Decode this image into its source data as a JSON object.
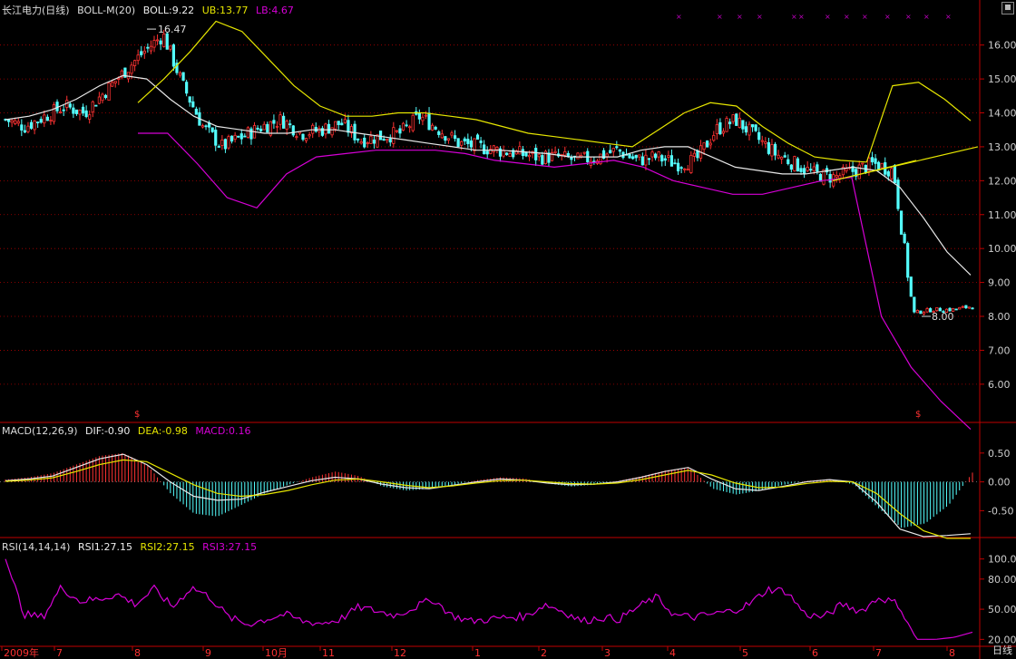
{
  "theme": {
    "bg": "#000000",
    "frame": "#c00000",
    "grid": "#b00000",
    "up": "#ff3232",
    "down": "#54ffff",
    "mid": "#e8e8e8",
    "ub": "#e6e600",
    "lb": "#d600d6",
    "text": "#cccccc"
  },
  "header": {
    "stock": "长江电力(日线)",
    "boll": {
      "name": "BOLL-M(20)",
      "boll": "BOLL:9.22",
      "ub": "UB:13.77",
      "lb": "LB:4.67"
    },
    "macd": {
      "name": "MACD(12,26,9)",
      "dif": "DIF:-0.90",
      "dea": "DEA:-0.98",
      "macd": "MACD:0.16"
    },
    "rsi": {
      "name": "RSI(14,14,14)",
      "rsi1": "RSI1:27.15",
      "rsi2": "RSI2:27.15",
      "rsi3": "RSI3:27.15"
    }
  },
  "mode_label": "日线",
  "chart_data": [
    {
      "type": "candlestick",
      "title": "长江电力(日线)",
      "ylim": [
        4.9,
        16.9
      ],
      "y_ticks": [
        "6.00",
        "7.00",
        "8.00",
        "9.00",
        "10.00",
        "11.00",
        "12.00",
        "13.00",
        "14.00",
        "15.00",
        "16.00"
      ],
      "x_ticks": [
        "2009年",
        "7",
        "8",
        "9",
        "10月",
        "11",
        "12",
        "1",
        "2",
        "3",
        "4",
        "5",
        "6",
        "7",
        "8"
      ],
      "annotations": {
        "high": "16.47",
        "low": "8.00",
        "marker": "$"
      },
      "close_trend": [
        13.8,
        13.6,
        13.9,
        14.2,
        14.0,
        14.6,
        15.2,
        15.8,
        16.3,
        14.8,
        13.6,
        13.0,
        13.3,
        13.6,
        13.8,
        13.4,
        13.5,
        13.7,
        13.2,
        13.3,
        13.4,
        13.9,
        13.5,
        13.1,
        13.0,
        12.9,
        12.8,
        12.7,
        12.7,
        12.6,
        12.7,
        12.9,
        12.6,
        12.7,
        12.5,
        12.6,
        13.5,
        13.8,
        13.3,
        12.8,
        12.5,
        12.2,
        12.1,
        12.3,
        12.5,
        12.3,
        8.1,
        8.2,
        8.2,
        8.3
      ],
      "boll_mid": [
        13.8,
        13.9,
        14.1,
        14.4,
        14.8,
        15.1,
        15.0,
        14.4,
        13.9,
        13.6,
        13.5,
        13.4,
        13.4,
        13.5,
        13.5,
        13.4,
        13.3,
        13.2,
        13.1,
        13.0,
        12.9,
        12.9,
        12.85,
        12.8,
        12.7,
        12.7,
        12.7,
        12.9,
        13.0,
        13.0,
        12.7,
        12.4,
        12.3,
        12.2,
        12.2,
        12.3,
        12.4,
        12.3,
        11.8,
        10.9,
        9.9,
        9.22
      ],
      "boll_ub": [
        14.3,
        15.0,
        15.8,
        16.7,
        16.4,
        15.6,
        14.8,
        14.2,
        13.9,
        13.9,
        14.0,
        14.0,
        13.9,
        13.8,
        13.6,
        13.4,
        13.3,
        13.2,
        13.1,
        13.0,
        13.5,
        14.0,
        14.3,
        14.2,
        13.6,
        13.1,
        12.7,
        12.6,
        12.55,
        14.8,
        14.9,
        14.4,
        13.77
      ],
      "boll_lb": [
        13.4,
        13.4,
        12.5,
        11.5,
        11.2,
        12.2,
        12.7,
        12.8,
        12.9,
        12.9,
        12.9,
        12.8,
        12.6,
        12.5,
        12.4,
        12.5,
        12.6,
        12.4,
        12.0,
        11.8,
        11.6,
        11.6,
        11.8,
        12.0,
        12.1,
        8.0,
        6.5,
        5.5,
        4.67
      ],
      "trend_lines": [
        {
          "from": [
            12.0,
            12.6
          ],
          "to": [
            12.6,
            13.0
          ]
        }
      ]
    },
    {
      "type": "bar",
      "title": "MACD(12,26,9)",
      "ylim": [
        -0.95,
        0.78
      ],
      "y_ticks": [
        "0.50",
        "0.00",
        "-0.50"
      ],
      "macd": [
        0.04,
        0.08,
        0.15,
        0.3,
        0.45,
        0.5,
        0.3,
        -0.2,
        -0.55,
        -0.6,
        -0.4,
        -0.2,
        -0.05,
        0.08,
        0.18,
        0.1,
        -0.08,
        -0.15,
        -0.12,
        -0.05,
        0.03,
        0.08,
        0.06,
        -0.03,
        -0.08,
        -0.05,
        0.02,
        0.1,
        0.2,
        0.25,
        -0.12,
        -0.22,
        -0.15,
        -0.05,
        0.02,
        0.05,
        -0.05,
        -0.45,
        -0.8,
        -0.72,
        -0.4,
        0.16
      ],
      "dif": [
        0.02,
        0.05,
        0.1,
        0.25,
        0.4,
        0.48,
        0.3,
        0.0,
        -0.25,
        -0.32,
        -0.3,
        -0.18,
        -0.08,
        0.02,
        0.08,
        0.05,
        -0.04,
        -0.1,
        -0.12,
        -0.06,
        0.0,
        0.05,
        0.03,
        -0.02,
        -0.05,
        -0.04,
        0.0,
        0.08,
        0.18,
        0.25,
        0.05,
        -0.12,
        -0.15,
        -0.08,
        0.0,
        0.04,
        0.0,
        -0.35,
        -0.82,
        -0.95,
        -0.93,
        -0.9
      ],
      "dea": [
        0.01,
        0.03,
        0.07,
        0.18,
        0.3,
        0.38,
        0.35,
        0.15,
        -0.05,
        -0.2,
        -0.25,
        -0.22,
        -0.15,
        -0.05,
        0.03,
        0.05,
        0.0,
        -0.06,
        -0.1,
        -0.07,
        -0.02,
        0.02,
        0.03,
        0.0,
        -0.03,
        -0.04,
        -0.02,
        0.04,
        0.12,
        0.2,
        0.12,
        -0.02,
        -0.1,
        -0.09,
        -0.03,
        0.01,
        0.0,
        -0.2,
        -0.55,
        -0.85,
        -0.98,
        -0.98
      ]
    },
    {
      "type": "line",
      "title": "RSI(14,14,14)",
      "ylim": [
        14,
        106
      ],
      "y_ticks": [
        "100.00",
        "80.00",
        "50.00",
        "20.00"
      ],
      "rsi": [
        100,
        45,
        42,
        72,
        58,
        60,
        65,
        55,
        70,
        52,
        72,
        62,
        42,
        35,
        40,
        45,
        38,
        36,
        40,
        52,
        48,
        44,
        52,
        60,
        44,
        38,
        40,
        42,
        43,
        55,
        48,
        38,
        42,
        40,
        52,
        62,
        44,
        42,
        45,
        48,
        55,
        70,
        68,
        45,
        42,
        55,
        48,
        62,
        55,
        20,
        20,
        22,
        27.15
      ]
    }
  ]
}
